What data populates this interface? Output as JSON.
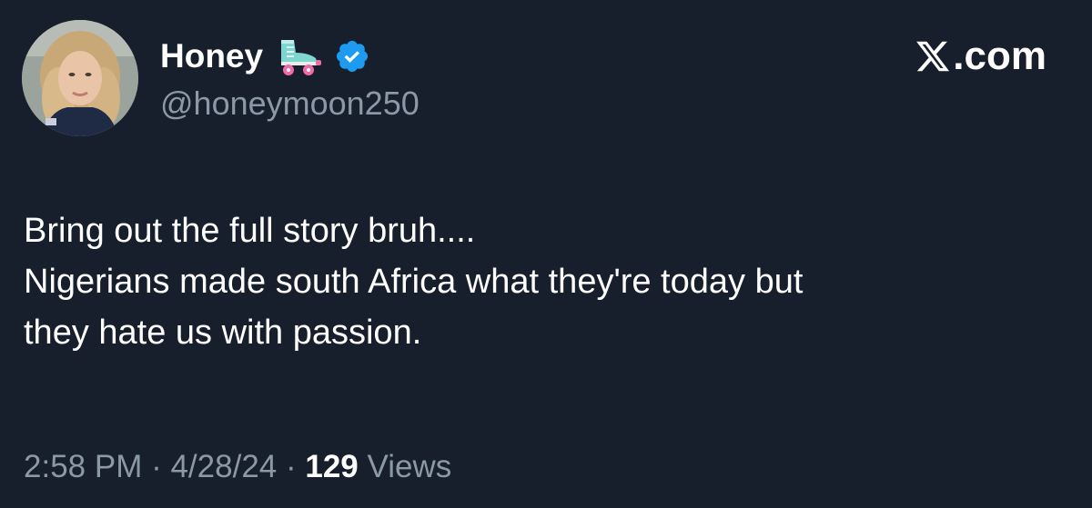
{
  "author": {
    "display_name": "Honey",
    "handle": "@honeymoon250",
    "verified": true
  },
  "brand": {
    "label": ".com",
    "icon": "x-logo-icon"
  },
  "tweet": {
    "lines": [
      "Bring out the full story bruh....",
      "Nigerians made south Africa what they're today but",
      "they hate us with passion."
    ]
  },
  "meta": {
    "time": "2:58 PM",
    "separator": " · ",
    "date": "4/28/24",
    "views_count": "129",
    "views_label": " Views"
  },
  "colors": {
    "background": "#161f2b",
    "secondary_text": "#8b98a5",
    "verified_blue": "#1d9bf0"
  }
}
